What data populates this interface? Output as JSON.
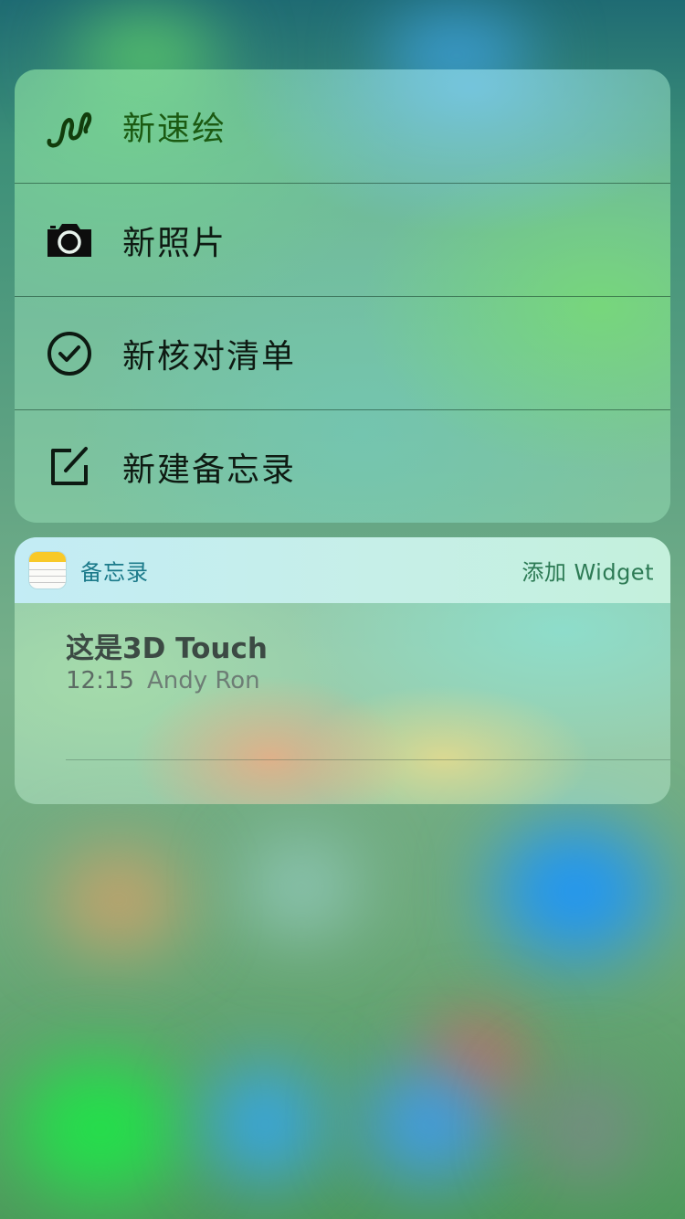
{
  "quick_actions": [
    {
      "label": "新速绘",
      "icon": "squiggle-sketch-icon"
    },
    {
      "label": "新照片",
      "icon": "camera-icon"
    },
    {
      "label": "新核对清单",
      "icon": "checkmark-circle-icon"
    },
    {
      "label": "新建备忘录",
      "icon": "compose-icon"
    }
  ],
  "widget": {
    "app_name": "备忘录",
    "app_icon": "notes-app-icon",
    "add_widget_label": "添加 Widget",
    "note": {
      "title": "这是3D Touch",
      "time": "12:15",
      "author": "Andy Ron"
    }
  },
  "colors": {
    "sketch_label": "#1b5a12",
    "widget_app_name": "#1b7a8a",
    "add_widget": "#2c7a54",
    "notes_icon_yellow": "#f8c928"
  }
}
